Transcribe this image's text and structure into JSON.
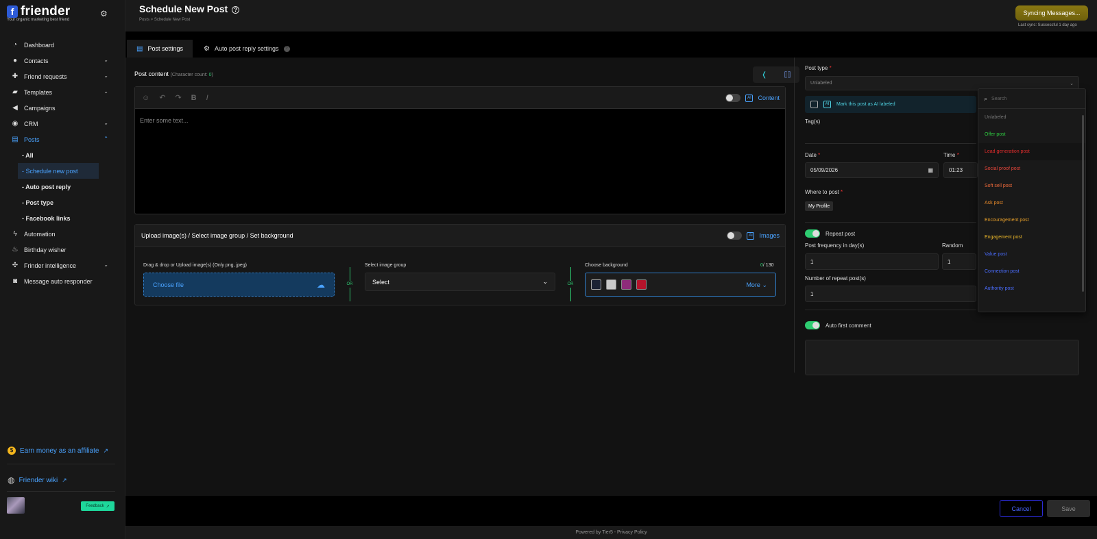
{
  "brand": {
    "logo_letter": "f",
    "name": "friender",
    "tagline": "Your organic marketing best friend"
  },
  "sidebar": {
    "items": [
      {
        "label": "Dashboard",
        "icon": "pie-chart-icon"
      },
      {
        "label": "Contacts",
        "icon": "user-icon"
      },
      {
        "label": "Friend requests",
        "icon": "user-plus-icon"
      },
      {
        "label": "Templates",
        "icon": "message-icon"
      },
      {
        "label": "Campaigns",
        "icon": "megaphone-icon"
      },
      {
        "label": "CRM",
        "icon": "crm-icon"
      },
      {
        "label": "Posts",
        "icon": "document-icon"
      },
      {
        "label": "Automation",
        "icon": "bolt-icon"
      },
      {
        "label": "Birthday wisher",
        "icon": "cake-icon"
      },
      {
        "label": "Frinder intelligence",
        "icon": "brain-icon"
      },
      {
        "label": "Message auto responder",
        "icon": "robot-icon"
      }
    ],
    "posts_sub": [
      "- All",
      "- Schedule new post",
      "- Auto post reply",
      "- Post type",
      "- Facebook links"
    ],
    "affiliate": "Earn money as an affiliate",
    "wiki": "Friender wiki",
    "feedback": "Feedback"
  },
  "header": {
    "title": "Schedule New Post",
    "breadcrumb": "Posts  >  Schedule New Post",
    "sync_button": "Syncing Messages...",
    "last_sync": "Last sync: Successful 1 day ago"
  },
  "tabs": [
    "Post settings",
    "Auto post reply settings"
  ],
  "editor": {
    "label": "Post content",
    "char_count_prefix": "(Character count: ",
    "char_count": "0",
    "char_count_suffix": ")",
    "content_toggle_label": "Content",
    "ai_badge": "AI",
    "placeholder": "Enter some text..."
  },
  "upload": {
    "title": "Upload image(s) / Select image group / Set background",
    "images_label": "Images",
    "drag_label": "Drag & drop or Upload image(s) (Only png, jpeg)",
    "choose_file": "Choose file",
    "or": "OR",
    "group_label": "Select image group",
    "group_value": "Select",
    "bg_label": "Choose background",
    "bg_count": "0",
    "bg_max": "/ 130",
    "more": "More",
    "swatches": [
      "#1b2233",
      "#c8c8c8",
      "#8e2b7a",
      "#b3142b"
    ]
  },
  "right": {
    "post_type_label": "Post type",
    "post_type_value": "Unlabeled",
    "ai_mark": "Mark this post as AI labeled",
    "tags_label": "Tag(s)",
    "date_label": "Date",
    "date_value": "05/09/2026",
    "time_label": "Time",
    "time_value": "01:23",
    "where_label": "Where to post",
    "where_chip": "My Profile",
    "repeat_label": "Repeat post",
    "freq_label": "Post frequency in day(s)",
    "freq_value": "1",
    "random_label": "Random",
    "random_value": "1",
    "num_label": "Number of repeat post(s)",
    "num_value": "1",
    "auto_comment_label": "Auto first comment",
    "required_mark": "*"
  },
  "dropdown": {
    "search_placeholder": "Search",
    "options": [
      {
        "label": "Unlabeled",
        "color": "#777777"
      },
      {
        "label": "Offer post",
        "color": "#2ecc40"
      },
      {
        "label": "Lead generation post",
        "color": "#e02c2c"
      },
      {
        "label": "Social proof post",
        "color": "#e8463a"
      },
      {
        "label": "Soft sell post",
        "color": "#ef6a3a"
      },
      {
        "label": "Ask post",
        "color": "#e88a2a"
      },
      {
        "label": "Encouragement post",
        "color": "#e8a02a"
      },
      {
        "label": "Engagement post",
        "color": "#e8b52a"
      },
      {
        "label": "Value post",
        "color": "#4a6dff"
      },
      {
        "label": "Connection post",
        "color": "#4a6dff"
      },
      {
        "label": "Authority post",
        "color": "#4a6dff"
      }
    ]
  },
  "footer": {
    "cancel": "Cancel",
    "save": "Save",
    "powered": "Powered by Tier5 - Privacy Policy"
  }
}
